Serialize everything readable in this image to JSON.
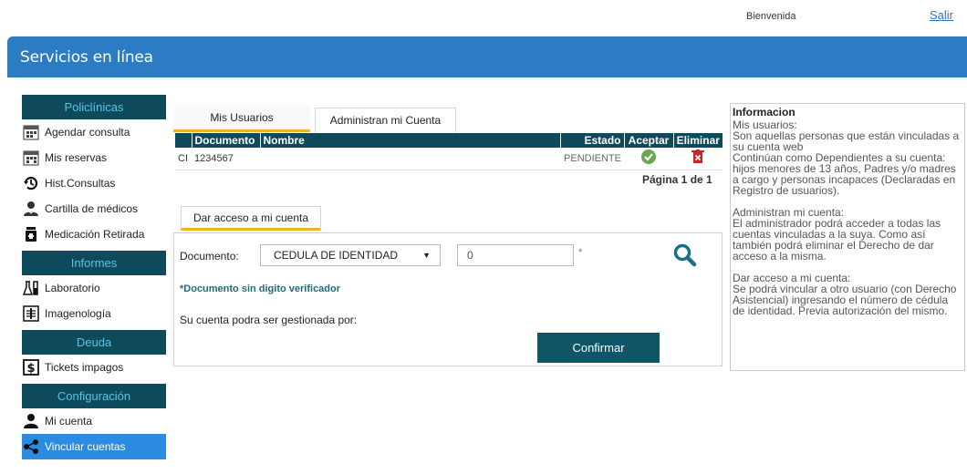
{
  "header": {
    "welcome": "Bienvenida",
    "logout": "Salir",
    "title": "Servicios en línea"
  },
  "sidebar": {
    "sections": [
      {
        "title": "Policlínicas",
        "items": [
          {
            "label": "Agendar consulta",
            "icon": "calendar-icon"
          },
          {
            "label": "Mis reservas",
            "icon": "calendar-icon"
          },
          {
            "label": "Hist.Consultas",
            "icon": "history-icon"
          },
          {
            "label": "Cartilla de médicos",
            "icon": "doctor-icon"
          },
          {
            "label": "Medicación Retirada",
            "icon": "medication-icon"
          }
        ]
      },
      {
        "title": "Informes",
        "items": [
          {
            "label": "Laboratorio",
            "icon": "lab-icon"
          },
          {
            "label": "Imagenología",
            "icon": "xray-icon"
          }
        ]
      },
      {
        "title": "Deuda",
        "items": [
          {
            "label": "Tickets impagos",
            "icon": "ticket-icon"
          }
        ]
      },
      {
        "title": "Configuración",
        "items": [
          {
            "label": "Mi cuenta",
            "icon": "user-icon"
          },
          {
            "label": "Vincular cuentas",
            "icon": "share-icon",
            "active": true
          }
        ]
      }
    ]
  },
  "tabs": {
    "mis_usuarios": "Mis Usuarios",
    "administran": "Administran mi Cuenta"
  },
  "table": {
    "headers": [
      "",
      "Documento",
      "Nombre",
      "Estado",
      "Aceptar",
      "Eliminar"
    ],
    "rows": [
      {
        "tipo": "CI",
        "documento": "1234567",
        "nombre": "",
        "estado": "PENDIENTE"
      }
    ]
  },
  "pager": "Página  1 de 1",
  "form": {
    "tab": "Dar acceso a mi cuenta",
    "doc_label": "Documento:",
    "doc_type": "CEDULA DE IDENTIDAD",
    "doc_value": "0",
    "required": "*",
    "note": "*Documento sin digito verificador",
    "gestion": "Su cuenta podra ser gestionada por:",
    "confirm": "Confirmar"
  },
  "info": {
    "title": "Informacion",
    "p1": "Mis usuarios:\nSon aquellas personas que están vinculadas a su cuenta web\nContinúan como Dependientes a su cuenta: hijos menores de 13 años, Padres y/o madres a cargo y personas incapaces (Declaradas en Registro de usuarios).",
    "p2": "Administran mi cuenta:\nEl administrador podrá acceder a todas las cuentas vinculadas a la suya. Como así también podrá eliminar el Derecho de dar acceso a la misma.",
    "p3": "Dar acceso a mi cuenta:\nSe podrá vincular a otro usuario (con Derecho Asistencial) ingresando el número de cédula de identidad. Previa autorización del mismo."
  },
  "colors": {
    "banner": "#2b7cc2",
    "dark_teal": "#0c4a5c",
    "accent_tab": "#f0b323",
    "active_item": "#2b8be0"
  }
}
